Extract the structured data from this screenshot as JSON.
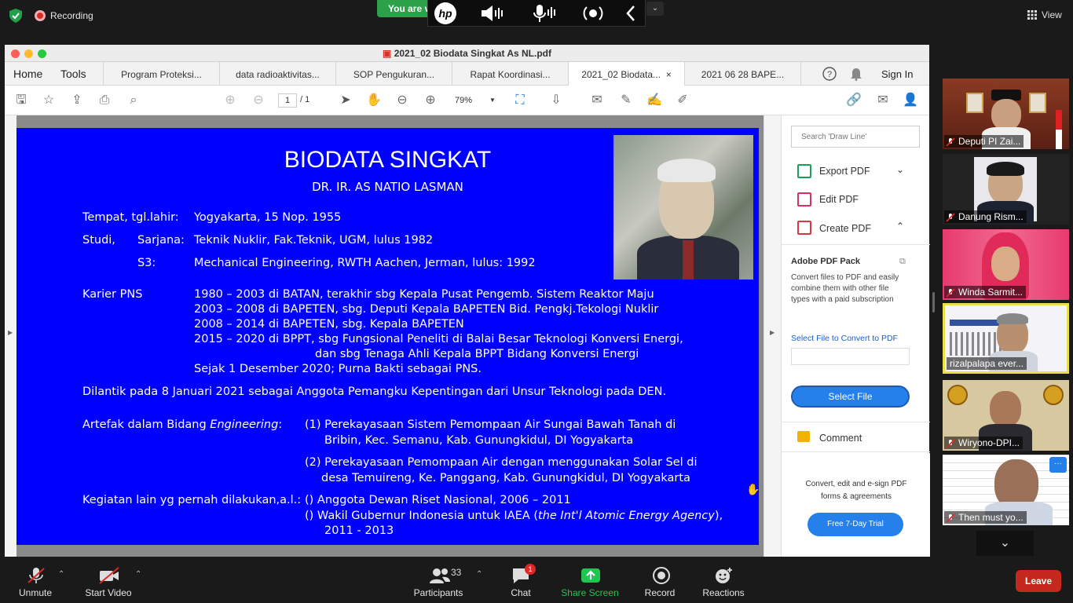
{
  "zoom": {
    "recording_label": "Recording",
    "banner_text": "You are v",
    "view_label": "View",
    "bottom_bar": {
      "unmute": "Unmute",
      "start_video": "Start Video",
      "participants_count": "33",
      "participants": "Participants",
      "chat": "Chat",
      "chat_badge": "1",
      "share_screen": "Share Screen",
      "record": "Record",
      "reactions": "Reactions",
      "leave": "Leave"
    },
    "participants": [
      {
        "name": "Deputi PI Zai..."
      },
      {
        "name": "Danung Rism..."
      },
      {
        "name": "Winda Sarmit..."
      },
      {
        "name": "rizalpalapa ever..."
      },
      {
        "name": "Wiryono-DPI..."
      },
      {
        "name": "Then must yo..."
      }
    ],
    "more_label": "···"
  },
  "acrobat": {
    "window_title": "2021_02 Biodata Singkat As NL.pdf",
    "nav": {
      "home": "Home",
      "tools": "Tools",
      "sign_in": "Sign In"
    },
    "tabs": [
      {
        "label": "Program Proteksi..."
      },
      {
        "label": "data radioaktivitas..."
      },
      {
        "label": "SOP Pengukuran..."
      },
      {
        "label": "Rapat Koordinasi..."
      },
      {
        "label": "2021_02 Biodata...",
        "close": "×"
      },
      {
        "label": "2021 06 28 BAPE..."
      }
    ],
    "toolbar": {
      "page_current": "1",
      "page_total": "/ 1",
      "zoom": "79%"
    },
    "right_panel": {
      "search_placeholder": "Search 'Draw Line'",
      "export_pdf": "Export PDF",
      "edit_pdf": "Edit PDF",
      "create_pdf": "Create PDF",
      "pack_title": "Adobe PDF Pack",
      "pack_desc": "Convert files to PDF and easily combine them with other file types with a paid subscription",
      "select_convert_link": "Select File to Convert to PDF",
      "select_file": "Select File",
      "comment": "Comment",
      "promo": "Convert, edit and e-sign PDF forms & agreements",
      "trial": "Free 7-Day Trial"
    }
  },
  "slide": {
    "title": "BIODATA SINGKAT",
    "subtitle": "DR. IR. AS NATIO LASMAN",
    "birth_label": "Tempat, tgl.lahir:",
    "birth_value": "Yogyakarta, 15 Nop. 1955",
    "studi_label": "Studi,",
    "sarjana_label": "Sarjana:",
    "sarjana_value": "Teknik Nuklir, Fak.Teknik, UGM, lulus 1982",
    "s3_label": "S3:",
    "s3_value": "Mechanical Engineering, RWTH Aachen, Jerman, lulus: 1992",
    "karier_label": "Karier PNS",
    "karier_lines": [
      "1980 – 2003 di BATAN, terakhir sbg Kepala Pusat Pengemb. Sistem Reaktor Maju",
      "2003 – 2008 di BAPETEN, sbg. Deputi Kepala BAPETEN Bid. Pengkj.Tekologi Nuklir",
      "2008 – 2014 di BAPETEN, sbg. Kepala BAPETEN",
      "2015 – 2020 di BPPT, sbg Fungsional Peneliti di Balai Besar Teknologi Konversi Energi,",
      "dan sbg Tenaga Ahli Kepala BPPT Bidang Konversi Energi",
      "Sejak 1 Desember 2020; Purna Bakti sebagai PNS."
    ],
    "dilantik": "Dilantik pada 8 Januari 2021 sebagai Anggota Pemangku Kepentingan dari Unsur Teknologi pada DEN.",
    "artefak_label": "Artefak dalam Bidang ",
    "artefak_label_em": "Engineering",
    "artefak_colon": ":",
    "artefak_1a": "(1) Perekayasaan Sistem Pemompaan Air Sungai Bawah Tanah di",
    "artefak_1b": "Bribin, Kec. Semanu, Kab. Gunungkidul, DI Yogyakarta",
    "artefak_2a": "(2) Perekayasaan Pemompaan Air dengan menggunakan Solar Sel di",
    "artefak_2b": "desa Temuireng, Ke. Panggang, Kab. Gunungkidul, DI Yogyakarta",
    "kegiatan_label": "Kegiatan lain yg pernah dilakukan,a.l.:",
    "kegiatan_1": "()   Anggota Dewan Riset Nasional, 2006 – 2011",
    "kegiatan_2a": "()   Wakil Gubernur Indonesia untuk IAEA (",
    "kegiatan_2em": "the Int'l Atomic Energy Agency",
    "kegiatan_2b": "),",
    "kegiatan_2c": "2011 - 2013"
  }
}
